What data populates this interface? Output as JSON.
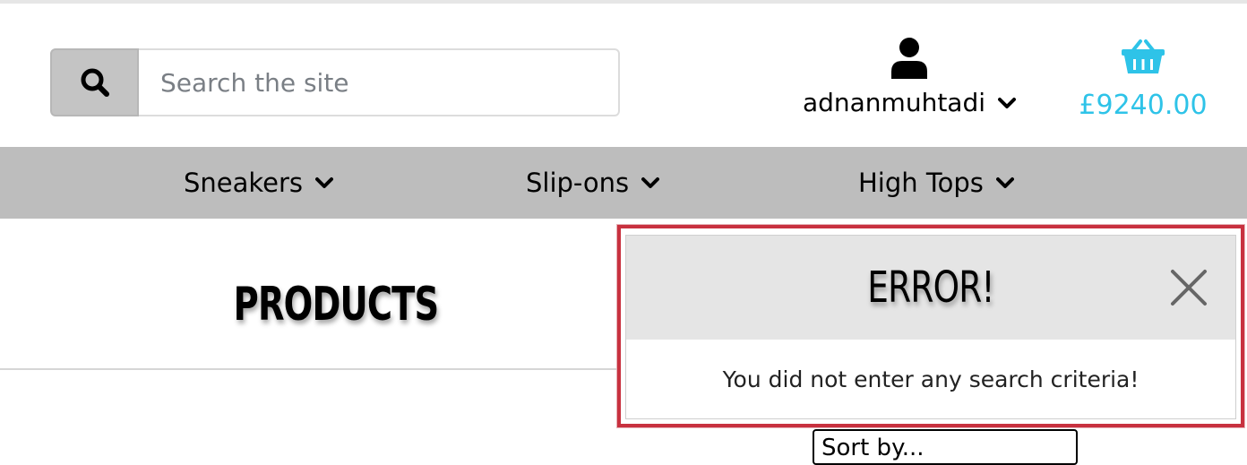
{
  "search": {
    "placeholder": "Search the site",
    "value": "",
    "button_icon": "search-icon"
  },
  "account": {
    "icon": "user-icon",
    "username": "adnanmuhtadi"
  },
  "cart": {
    "icon": "basket-icon",
    "total": "£9240.00",
    "color": "#2ec3e8"
  },
  "nav": {
    "items": [
      {
        "label": "Sneakers"
      },
      {
        "label": "Slip-ons"
      },
      {
        "label": "High Tops"
      }
    ]
  },
  "main": {
    "title": "PRODUCTS",
    "sort_label": "Sort by..."
  },
  "toast": {
    "title": "ERROR!",
    "message": "You did not enter any search criteria!",
    "border_color": "#c8313f"
  }
}
